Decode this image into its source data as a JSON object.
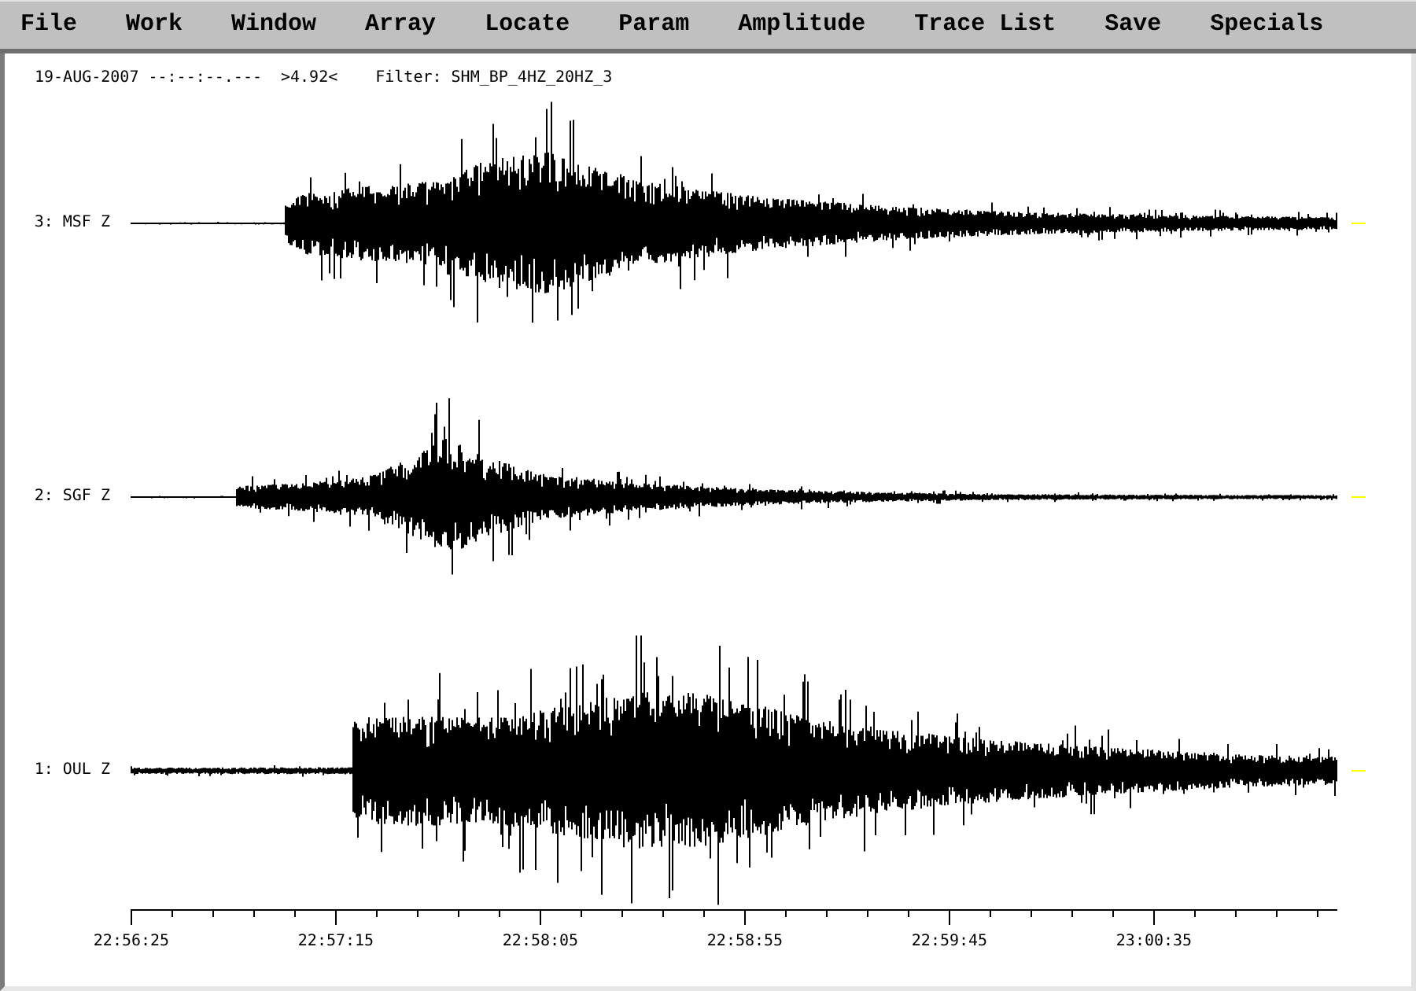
{
  "menu": [
    "File",
    "Work",
    "Window",
    "Array",
    "Locate",
    "Param",
    "Amplitude",
    "Trace List",
    "Save",
    "Specials"
  ],
  "header": {
    "datetime": "19-AUG-2007 --:--:--.---",
    "value": ">4.92<",
    "filter": "Filter: SHM_BP_4HZ_20HZ_3"
  },
  "traces": [
    {
      "label": "3: MSF Z"
    },
    {
      "label": "2: SGF Z"
    },
    {
      "label": "1: OUL Z"
    }
  ],
  "time_axis": {
    "tick_labels": [
      "22:56:25",
      "22:57:15",
      "22:58:05",
      "22:58:55",
      "22:59:45",
      "23:00:35"
    ]
  }
}
